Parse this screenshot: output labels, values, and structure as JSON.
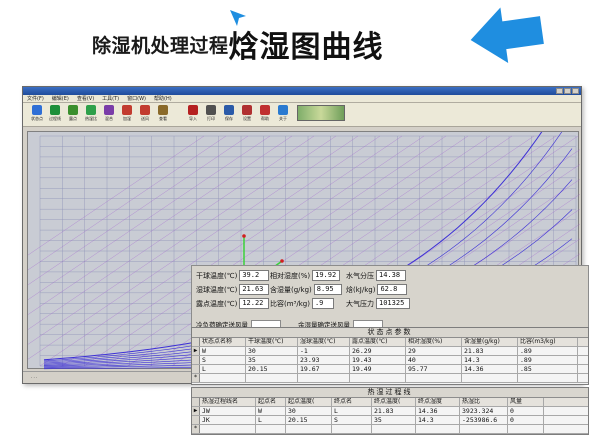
{
  "headline": {
    "part1": "除湿机处理过程",
    "part2": "焓湿图曲线"
  },
  "colors": {
    "arrow": "#1f8ee0",
    "chart_bg": "#c9ccd4",
    "process_line": "#3ad13a",
    "curve": "#3c2fd6"
  },
  "app": {
    "menus": [
      "文件(F)",
      "编辑(E)",
      "查看(V)",
      "工具(T)",
      "窗口(W)",
      "帮助(H)"
    ],
    "toolbar": [
      {
        "label": "状态点",
        "icon": "point-icon",
        "color": "#2f6fd6"
      },
      {
        "label": "过程线",
        "icon": "line-icon",
        "color": "#1d8f3a"
      },
      {
        "label": "露点",
        "icon": "dew-icon",
        "color": "#3a8f2d"
      },
      {
        "label": "热湿比",
        "icon": "ratio-icon",
        "color": "#2ea04a"
      },
      {
        "label": "混合",
        "icon": "mix-icon",
        "color": "#7a3ca8"
      },
      {
        "label": "加湿",
        "icon": "humid-icon",
        "color": "#c23b2f"
      },
      {
        "label": "送风",
        "icon": "fan-icon",
        "color": "#c23b2f"
      },
      {
        "label": "查看",
        "icon": "view-icon",
        "color": "#8a6a2a"
      },
      {
        "label": "导入",
        "icon": "import-icon",
        "color": "#b52020"
      },
      {
        "label": "打印",
        "icon": "print-icon",
        "color": "#505050"
      },
      {
        "label": "保存",
        "icon": "save-icon",
        "color": "#2a5aa8"
      },
      {
        "label": "设置",
        "icon": "settings-icon",
        "color": "#b03030"
      },
      {
        "label": "帮助",
        "icon": "help-icon",
        "color": "#c03030"
      },
      {
        "label": "关于",
        "icon": "about-icon",
        "color": "#2a7ad0"
      }
    ]
  },
  "properties": {
    "dry_bulb": {
      "label": "干球温度(℃)",
      "value": "39.2"
    },
    "wet_bulb": {
      "label": "湿球温度(℃)",
      "value": "21.63"
    },
    "dew_point": {
      "label": "露点温度(℃)",
      "value": "12.22"
    },
    "rel_humidity": {
      "label": "相对湿度(%)",
      "value": "19.92"
    },
    "moisture": {
      "label": "含湿量(g/kg)",
      "value": "8.95"
    },
    "spec_volume": {
      "label": "比容(m³/kg)",
      "value": ".9"
    },
    "vapor_pressure": {
      "label": "水气分压",
      "value": "14.38"
    },
    "enthalpy": {
      "label": "焓(kJ/kg)",
      "value": "62.8"
    },
    "atm_pressure": {
      "label": "大气压力",
      "value": "101325"
    },
    "cold_load_check": "冷负荷确定送风量",
    "moist_load_check": "余湿量确定送风量"
  },
  "state_table": {
    "title": "状态点参数",
    "headers": [
      "状态点名称",
      "干球温度(℃)",
      "湿球温度(℃)",
      "露点温度(℃)",
      "相对湿度(%)",
      "含湿量(g/kg)",
      "比容(m3/kg)"
    ],
    "rows": [
      [
        "W",
        "30",
        "-1",
        "26.29",
        "29",
        "21.83",
        ".89"
      ],
      [
        "S",
        "35",
        "23.93",
        "19.43",
        "40",
        "14.3",
        ".89"
      ],
      [
        "L",
        "20.15",
        "19.67",
        "19.49",
        "95.77",
        "14.36",
        ".85"
      ],
      [
        "",
        "",
        "",
        "",
        "",
        "",
        ""
      ]
    ]
  },
  "process_table": {
    "title": "热湿过程线",
    "headers": [
      "热湿过程线名",
      "起点名",
      "起点温度(",
      "终点名",
      "终点温度(",
      "终点湿度",
      "热湿比",
      "风量"
    ],
    "rows": [
      [
        "JW",
        "W",
        "30",
        "L",
        "21.83",
        "14.36",
        "3923.324",
        "0"
      ],
      [
        "JK",
        "L",
        "20.15",
        "S",
        "35",
        "14.3",
        "-253986.6",
        "0"
      ],
      [
        "",
        "",
        "",
        "",
        "",
        "",
        "",
        ""
      ]
    ]
  }
}
